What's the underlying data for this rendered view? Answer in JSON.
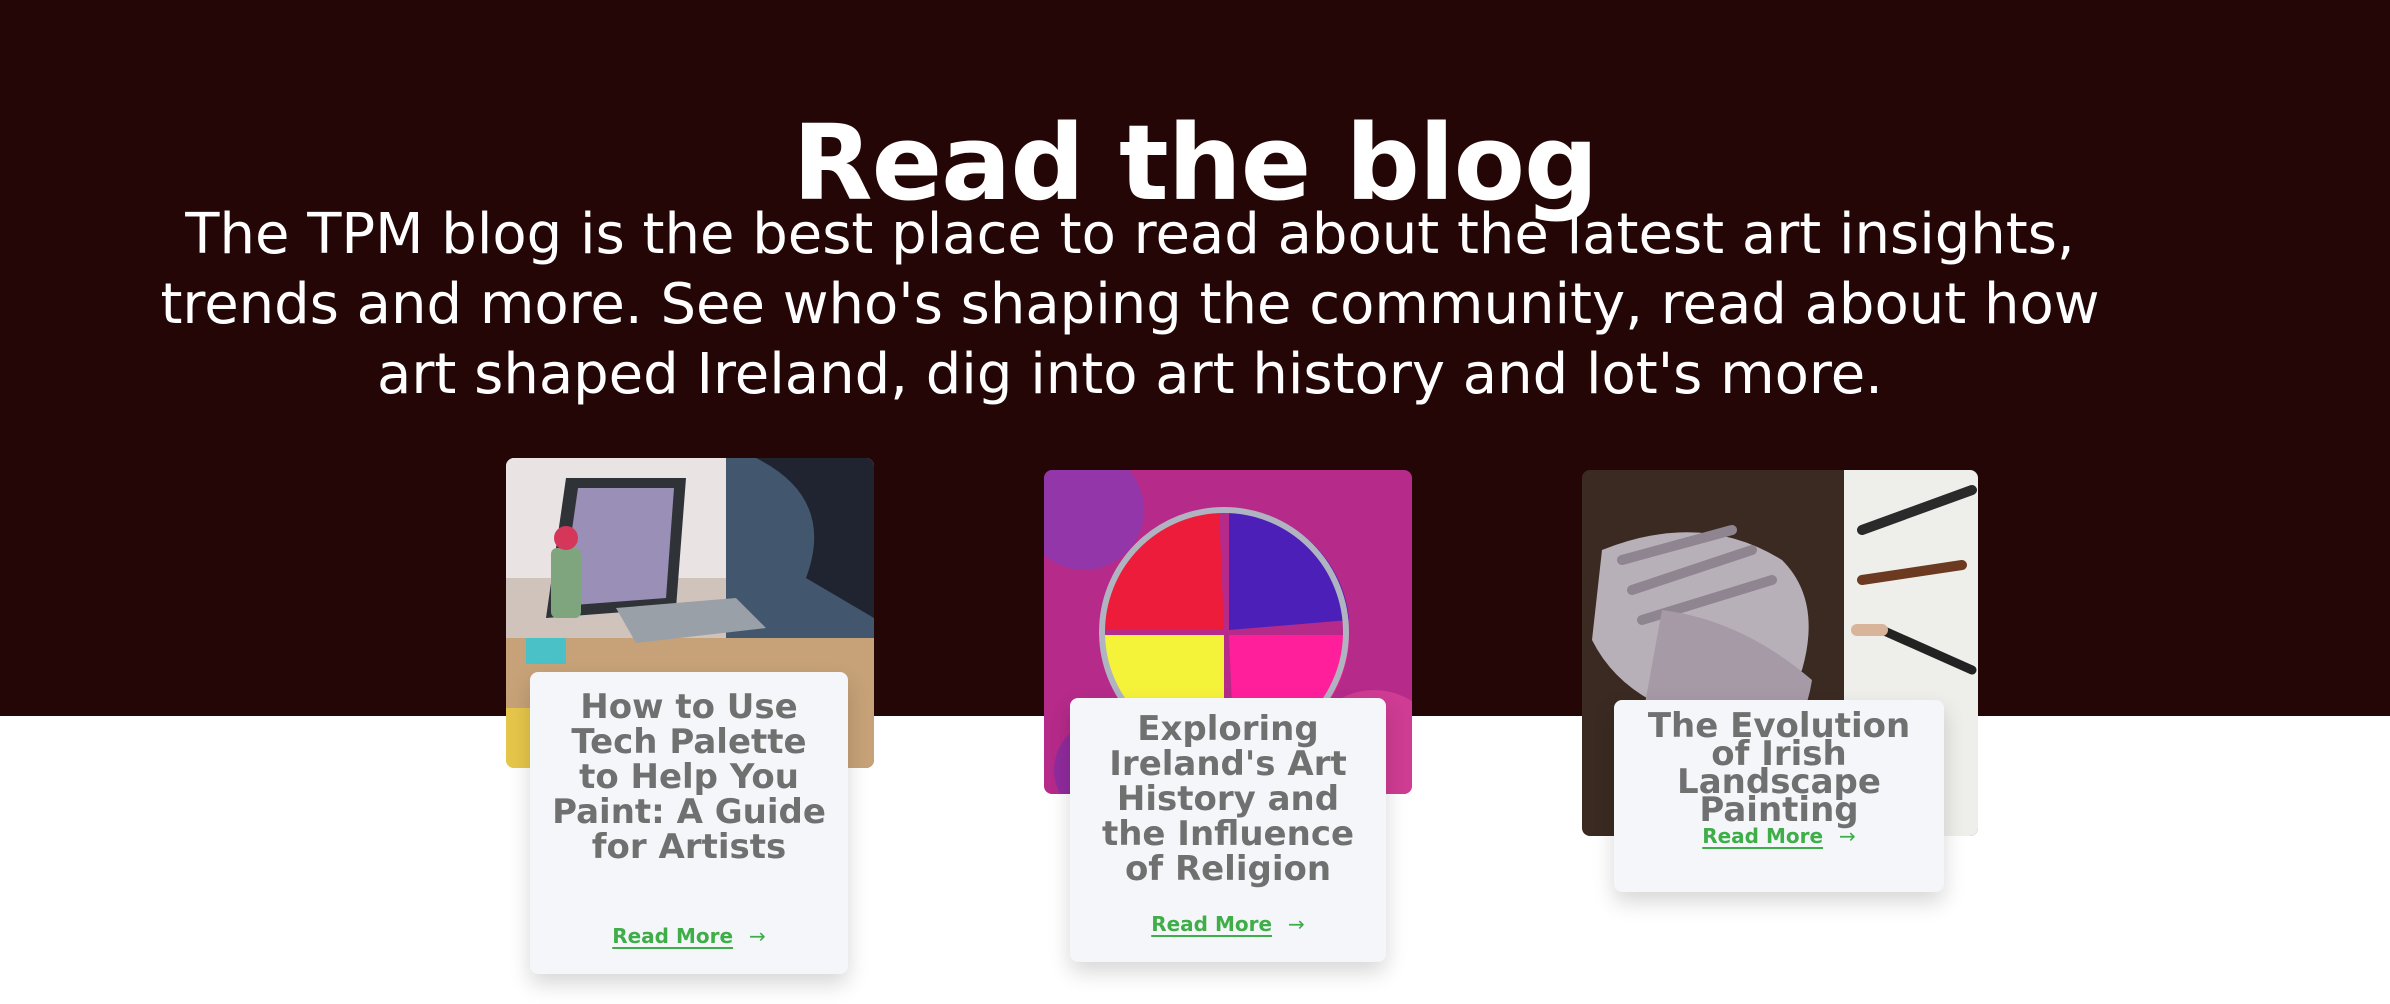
{
  "hero": {
    "title": "Read the blog",
    "intro": "The TPM blog is the best place to read about the latest art insights, trends and more. See who's shaping the community, read about how art shaped Ireland, dig into art history and lot's more.",
    "background_color": "#240606"
  },
  "posts": [
    {
      "title": "How to Use Tech Palette to Help You Paint: A Guide for Artists",
      "read_more": "Read More",
      "arrow_icon": "arrow-right-icon",
      "image": "artist-at-laptop-photo"
    },
    {
      "title": "Exploring Ireland's Art History and the Influence of Religion",
      "read_more": "Read More",
      "arrow_icon": "arrow-right-icon",
      "image": "colored-powder-palette-photo"
    },
    {
      "title": "The Evolution of Irish Landscape Painting",
      "read_more": "Read More",
      "arrow_icon": "arrow-right-icon",
      "image": "painted-hands-brushes-photo"
    }
  ],
  "colors": {
    "accent": "#3fae49",
    "card_bg": "#f4f6f9",
    "card_text": "#707070"
  }
}
